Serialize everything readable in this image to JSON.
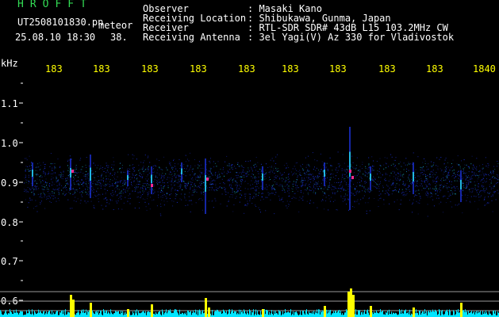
{
  "header": {
    "app_name": "HROFFT",
    "filename": "UT2508101830.pn",
    "mode": "meteor",
    "datetime": "25.08.10 18:30",
    "count": "38.",
    "labels": {
      "observer": "Observer",
      "location": "Receiving Location",
      "receiver": "Receiver",
      "antenna": "Receiving Antenna"
    },
    "values": {
      "observer": ": Masaki Kano",
      "location": ": Shibukawa, Gunma, Japan",
      "receiver": ": RTL-SDR SDR# 43dB L15 103.2MHz CW",
      "antenna": ": 3el Yagi(V) Az 330 for Vladivostok"
    }
  },
  "axis": {
    "unit": "kHz",
    "time_ticks": [
      "183",
      "183",
      "183",
      "183",
      "183",
      "183",
      "183",
      "183",
      "183",
      "1840"
    ],
    "freq_ticks": [
      "1.1",
      "1.0",
      "0.9",
      "0.8",
      "0.7",
      "0.6"
    ]
  },
  "colors": {
    "background": "#000000",
    "axis_text": "#ffffff",
    "time_text": "#ffff00",
    "title_text": "#33dd55",
    "signal_low": "#1a2fd0",
    "signal_mid": "#22c8e8",
    "signal_high": "#ff2a90",
    "meter_bar": "#ffff00",
    "meter_base": "#00e5ff"
  }
}
